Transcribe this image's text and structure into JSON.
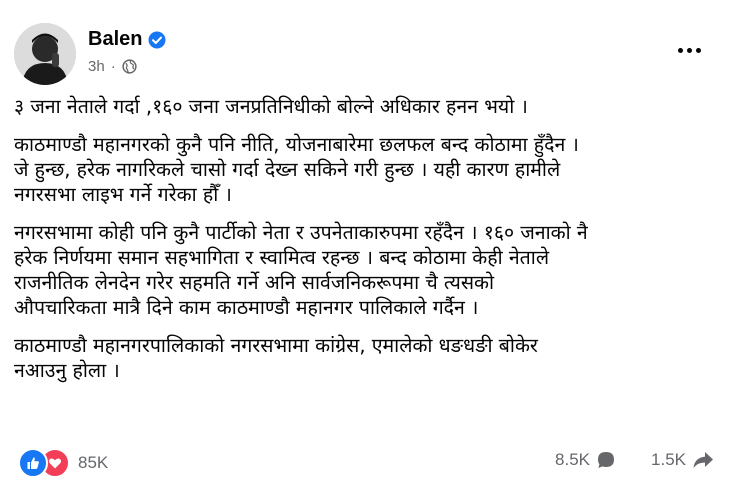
{
  "post": {
    "author": "Balen",
    "time": "3h",
    "separator": "·",
    "verified_icon": "verified-badge-icon",
    "privacy_icon": "globe-icon",
    "paragraphs": [
      "३ जना नेताले गर्दा ,१६० जना जनप्रतिनिधीको बोल्ने अधिकार हनन भयो ।",
      "काठमाण्डौ महानगरको कुनै पनि नीति, योजनाबारेमा छलफल बन्द कोठामा हुँदैन ।\nजे हुन्छ, हरेक नागरिकले चासो गर्दा देख्न सकिने गरी हुन्छ । यही कारण हामीले\nनगरसभा लाइभ गर्ने गरेका हौँ ।",
      "नगरसभामा कोही पनि कुनै पार्टीको नेता र उपनेताकारुपमा रहँदैन । १६० जनाको नै\nहरेक निर्णयमा समान सहभागिता र स्वामित्व रहन्छ । बन्द कोठामा केही नेताले\nराजनीतिक लेनदेन गरेर सहमति गर्ने अनि सार्वजनिकरूपमा चै त्यसको\nऔपचारिकता मात्रै दिने काम काठमाण्डौ महानगर पालिकाले गर्दैन ।",
      "काठमाण्डौ महानगरपालिकाको नगरसभामा कांग्रेस, एमालेको धङधङी बोकेर\nनआउनु होला ।"
    ],
    "reactions_count": "85K",
    "comments_count": "8.5K",
    "shares_count": "1.5K"
  },
  "colors": {
    "like_blue": "#1877f2",
    "love_red": "#f33e58",
    "secondary_text": "#65676b"
  }
}
